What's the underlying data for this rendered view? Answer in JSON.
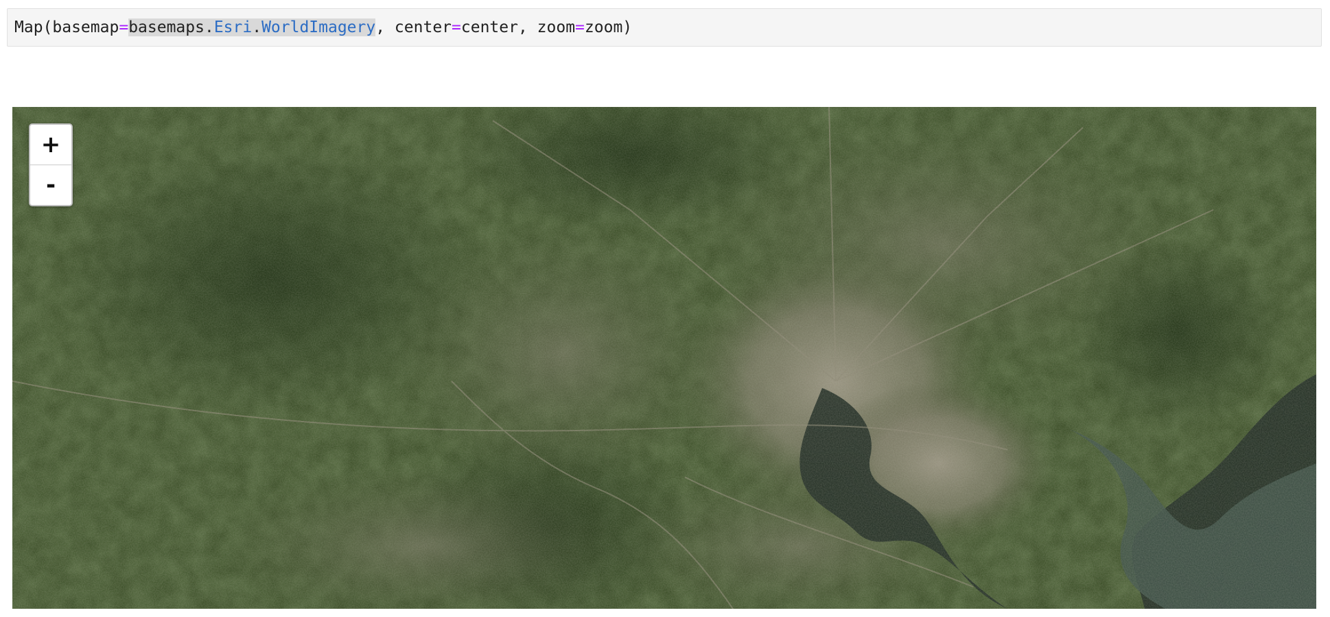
{
  "code_cell": {
    "prefix": "Map(basemap",
    "op1": "=",
    "sel_text_1": "basemaps.",
    "sel_attr_1": "Esri",
    "sel_dot": ".",
    "sel_attr_2": "WorldImagery",
    "middle_1": ", center",
    "op2": "=",
    "middle_2": "center, zoom",
    "op3": "=",
    "suffix": "zoom)"
  },
  "map": {
    "basemap_name": "Esri.WorldImagery",
    "zoom_in_label": "+",
    "zoom_out_label": "-",
    "colors": {
      "vegetation_dark": "#223515",
      "vegetation": "#3b4f26",
      "urban": "#8f8a78",
      "water": "#1f2a22"
    }
  }
}
